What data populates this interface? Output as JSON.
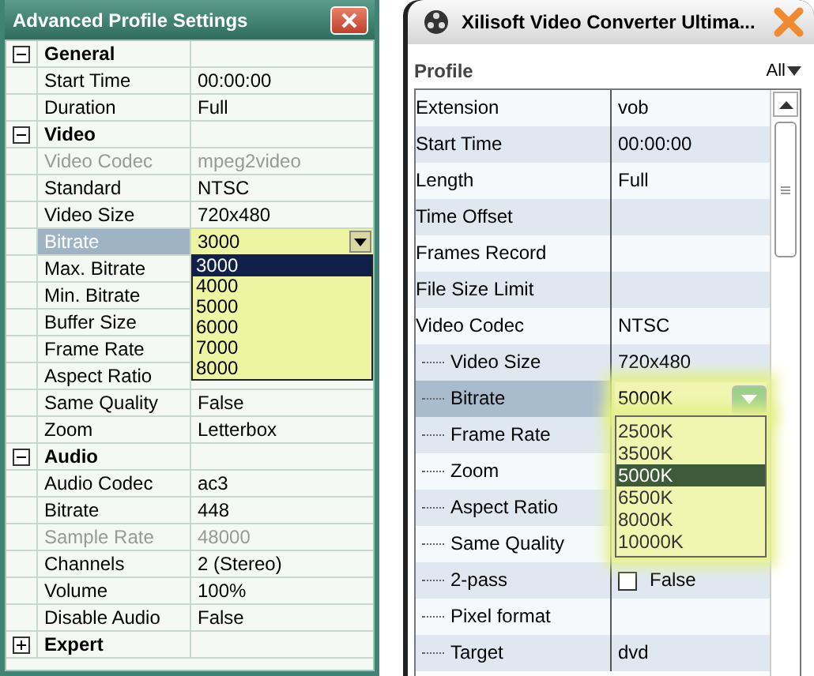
{
  "left": {
    "title": "Advanced Profile Settings",
    "groups": [
      {
        "label": "General",
        "expanded": true,
        "children": [
          {
            "label": "Start Time",
            "value": "00:00:00",
            "disabled": false,
            "selected": false
          },
          {
            "label": "Duration",
            "value": "Full",
            "disabled": false,
            "selected": false
          }
        ]
      },
      {
        "label": "Video",
        "expanded": true,
        "children": [
          {
            "label": "Video Codec",
            "value": "mpeg2video",
            "disabled": true,
            "selected": false
          },
          {
            "label": "Standard",
            "value": "NTSC",
            "disabled": false,
            "selected": false
          },
          {
            "label": "Video Size",
            "value": "720x480",
            "disabled": false,
            "selected": false
          },
          {
            "label": "Bitrate",
            "disabled": false,
            "selected": true,
            "dropdown": {
              "value": "3000",
              "options": [
                {
                  "label": "3000",
                  "selected": true
                },
                {
                  "label": "4000",
                  "selected": false
                },
                {
                  "label": "5000",
                  "selected": false
                },
                {
                  "label": "6000",
                  "selected": false
                },
                {
                  "label": "7000",
                  "selected": false
                },
                {
                  "label": "8000",
                  "selected": false
                }
              ]
            }
          },
          {
            "label": "Max. Bitrate",
            "disabled": false,
            "selected": false
          },
          {
            "label": "Min. Bitrate",
            "disabled": false,
            "selected": false
          },
          {
            "label": "Buffer Size",
            "disabled": false,
            "selected": false
          },
          {
            "label": "Frame Rate",
            "disabled": false,
            "selected": false
          },
          {
            "label": "Aspect Ratio",
            "disabled": false,
            "selected": false
          },
          {
            "label": "Same Quality",
            "value": "False",
            "disabled": false,
            "selected": false
          },
          {
            "label": "Zoom",
            "value": "Letterbox",
            "disabled": false,
            "selected": false
          }
        ]
      },
      {
        "label": "Audio",
        "expanded": true,
        "children": [
          {
            "label": "Audio Codec",
            "value": "ac3",
            "disabled": false,
            "selected": false
          },
          {
            "label": "Bitrate",
            "value": "448",
            "disabled": false,
            "selected": false
          },
          {
            "label": "Sample Rate",
            "value": "48000",
            "disabled": true,
            "selected": false
          },
          {
            "label": "Channels",
            "value": "2 (Stereo)",
            "disabled": false,
            "selected": false
          },
          {
            "label": "Volume",
            "value": "100%",
            "disabled": false,
            "selected": false
          },
          {
            "label": "Disable Audio",
            "value": "False",
            "disabled": false,
            "selected": false
          }
        ]
      },
      {
        "label": "Expert",
        "expanded": false
      }
    ]
  },
  "right": {
    "title": "Xilisoft Video Converter Ultima...",
    "header": "Profile",
    "filter": "All",
    "rows": [
      {
        "kind": "text",
        "label": "Extension",
        "value": "vob",
        "selected": false
      },
      {
        "kind": "text",
        "label": "Start Time",
        "value": "00:00:00",
        "selected": false
      },
      {
        "kind": "text",
        "label": "Length",
        "value": "Full",
        "selected": false
      },
      {
        "kind": "text",
        "label": "Time Offset",
        "selected": false
      },
      {
        "kind": "text",
        "label": "Frames Record",
        "selected": false
      },
      {
        "kind": "text",
        "label": "File Size Limit",
        "selected": false
      },
      {
        "kind": "text",
        "label": "Video Codec",
        "value": "NTSC",
        "selected": false,
        "children": [
          {
            "kind": "text",
            "label": "Video Size",
            "value": "720x480",
            "selected": false
          },
          {
            "kind": "dropdown",
            "label": "Bitrate",
            "selected": true,
            "dropdown": {
              "value": "5000K",
              "options": [
                {
                  "label": "2500K",
                  "selected": false
                },
                {
                  "label": "3500K",
                  "selected": false
                },
                {
                  "label": "5000K",
                  "selected": true
                },
                {
                  "label": "6500K",
                  "selected": false
                },
                {
                  "label": "8000K",
                  "selected": false
                },
                {
                  "label": "10000K",
                  "selected": false
                }
              ]
            }
          },
          {
            "kind": "text",
            "label": "Frame Rate",
            "selected": false
          },
          {
            "kind": "text",
            "label": "Zoom",
            "selected": false
          },
          {
            "kind": "text",
            "label": "Aspect Ratio",
            "selected": false
          },
          {
            "kind": "text",
            "label": "Same Quality",
            "selected": false
          },
          {
            "kind": "checkbox",
            "label": "2-pass",
            "value": "False",
            "checked": false,
            "selected": false
          },
          {
            "kind": "text",
            "label": "Pixel format",
            "selected": false
          },
          {
            "kind": "text",
            "label": "Target",
            "value": "dvd",
            "selected": false
          }
        ]
      }
    ]
  }
}
